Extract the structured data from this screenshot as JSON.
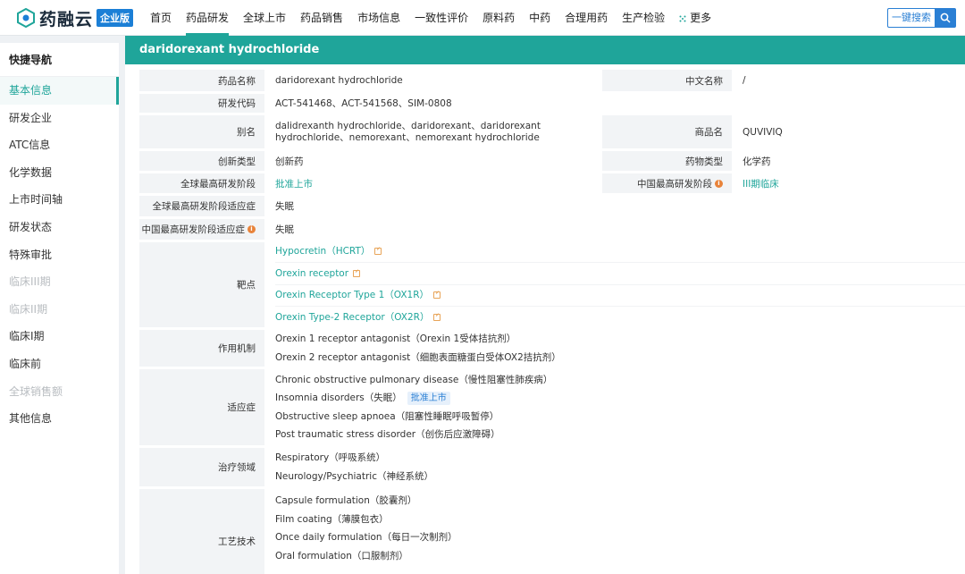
{
  "brand": {
    "name": "药融云",
    "badge": "企业版"
  },
  "nav": [
    {
      "label": "首页",
      "active": false
    },
    {
      "label": "药品研发",
      "active": true
    },
    {
      "label": "全球上市",
      "active": false
    },
    {
      "label": "药品销售",
      "active": false
    },
    {
      "label": "市场信息",
      "active": false
    },
    {
      "label": "一致性评价",
      "active": false
    },
    {
      "label": "原料药",
      "active": false
    },
    {
      "label": "中药",
      "active": false
    },
    {
      "label": "合理用药",
      "active": false
    },
    {
      "label": "生产检验",
      "active": false
    },
    {
      "label": "更多",
      "active": false
    }
  ],
  "search": {
    "label": "一键搜索"
  },
  "sidebar": {
    "title": "快捷导航",
    "items": [
      {
        "label": "基本信息",
        "state": "active"
      },
      {
        "label": "研发企业",
        "state": "normal"
      },
      {
        "label": "ATC信息",
        "state": "normal"
      },
      {
        "label": "化学数据",
        "state": "normal"
      },
      {
        "label": "上市时间轴",
        "state": "normal"
      },
      {
        "label": "研发状态",
        "state": "normal"
      },
      {
        "label": "特殊审批",
        "state": "normal"
      },
      {
        "label": "临床III期",
        "state": "disabled"
      },
      {
        "label": "临床II期",
        "state": "disabled"
      },
      {
        "label": "临床I期",
        "state": "normal"
      },
      {
        "label": "临床前",
        "state": "normal"
      },
      {
        "label": "全球销售额",
        "state": "disabled"
      },
      {
        "label": "其他信息",
        "state": "normal"
      }
    ]
  },
  "drug": {
    "header": "daridorexant hydrochloride",
    "name_label": "药品名称",
    "name": "daridorexant hydrochloride",
    "cn_name_label": "中文名称",
    "cn_name": "/",
    "code_label": "研发代码",
    "code": "ACT-541468、ACT-541568、SIM-0808",
    "alias_label": "别名",
    "alias_line1": "dalidrexanth hydrochloride、daridorexant、daridorexant",
    "alias_line2": "hydrochloride、nemorexant、nemorexant hydrochloride",
    "trade_label": "商品名",
    "trade": "QUVIVIQ",
    "innov_label": "创新类型",
    "innov": "创新药",
    "type_label": "药物类型",
    "type": "化学药",
    "gstage_label": "全球最高研发阶段",
    "gstage": "批准上市",
    "cstage_label": "中国最高研发阶段",
    "cstage": "III期临床",
    "gind_label": "全球最高研发阶段适应症",
    "gind": "失眠",
    "cind_label": "中国最高研发阶段适应症",
    "cind": "失眠",
    "target_label": "靶点",
    "targets": [
      "Hypocretin（HCRT）",
      "Orexin receptor",
      "Orexin Receptor Type 1（OX1R）",
      "Orexin Type-2 Receptor（OX2R）"
    ],
    "mech_label": "作用机制",
    "mechs": [
      "Orexin 1 receptor antagonist（Orexin 1受体拮抗剂）",
      "Orexin 2 receptor antagonist（细胞表面糖蛋白受体OX2拮抗剂）"
    ],
    "indic_label": "适应症",
    "indications": [
      "Chronic obstructive pulmonary disease（慢性阻塞性肺疾病）",
      "Insomnia disorders（失眠）",
      "Obstructive sleep apnoea（阻塞性睡眠呼吸暂停）",
      "Post traumatic stress disorder（创伤后应激障碍）"
    ],
    "indic_tag": "批准上市",
    "area_label": "治疗领域",
    "areas": [
      "Respiratory（呼吸系统）",
      "Neurology/Psychiatric（神经系统）"
    ],
    "tech_label": "工艺技术",
    "techs": [
      "Capsule formulation（胶囊剂）",
      "Film coating（薄膜包衣）",
      "Once daily formulation（每日一次制剂）",
      "Oral formulation（口服制剂）"
    ]
  },
  "colors": {
    "accent": "#1fa59a",
    "link_blue": "#2a7fd4",
    "info_orange": "#e8833a"
  }
}
